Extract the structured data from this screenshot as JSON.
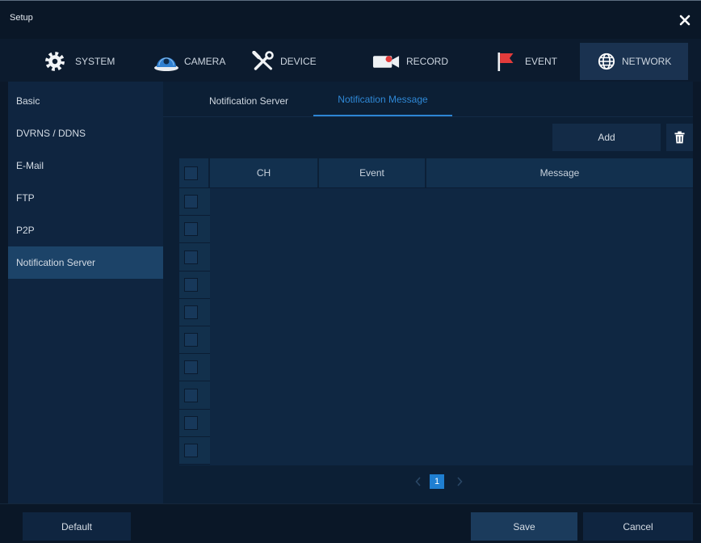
{
  "window": {
    "title": "Setup",
    "close_icon": "close-icon"
  },
  "tabs": [
    {
      "label": "SYSTEM",
      "icon": "gear-icon",
      "active": false
    },
    {
      "label": "CAMERA",
      "icon": "camera-icon",
      "active": false
    },
    {
      "label": "DEVICE",
      "icon": "tools-icon",
      "active": false
    },
    {
      "label": "RECORD",
      "icon": "record-icon",
      "active": false
    },
    {
      "label": "EVENT",
      "icon": "flag-icon",
      "active": false
    },
    {
      "label": "NETWORK",
      "icon": "globe-icon",
      "active": true
    }
  ],
  "sidebar": {
    "items": [
      {
        "label": "Basic",
        "active": false
      },
      {
        "label": "DVRNS / DDNS",
        "active": false
      },
      {
        "label": "E-Mail",
        "active": false
      },
      {
        "label": "FTP",
        "active": false
      },
      {
        "label": "P2P",
        "active": false
      },
      {
        "label": "Notification Server",
        "active": true
      }
    ]
  },
  "subtabs": [
    {
      "label": "Notification Server",
      "active": false
    },
    {
      "label": "Notification Message",
      "active": true
    }
  ],
  "toolbar": {
    "add_label": "Add",
    "delete_icon": "trash-icon"
  },
  "table": {
    "select_all_checked": false,
    "columns": [
      "CH",
      "Event",
      "Message"
    ],
    "rows": [
      {
        "checked": false,
        "ch": "",
        "event": "",
        "message": ""
      },
      {
        "checked": false,
        "ch": "",
        "event": "",
        "message": ""
      },
      {
        "checked": false,
        "ch": "",
        "event": "",
        "message": ""
      },
      {
        "checked": false,
        "ch": "",
        "event": "",
        "message": ""
      },
      {
        "checked": false,
        "ch": "",
        "event": "",
        "message": ""
      },
      {
        "checked": false,
        "ch": "",
        "event": "",
        "message": ""
      },
      {
        "checked": false,
        "ch": "",
        "event": "",
        "message": ""
      },
      {
        "checked": false,
        "ch": "",
        "event": "",
        "message": ""
      },
      {
        "checked": false,
        "ch": "",
        "event": "",
        "message": ""
      },
      {
        "checked": false,
        "ch": "",
        "event": "",
        "message": ""
      }
    ]
  },
  "pagination": {
    "prev_icon": "chevron-left-icon",
    "pages": [
      {
        "label": "1",
        "current": true
      }
    ],
    "next_icon": "chevron-right-icon"
  },
  "footer": {
    "default_label": "Default",
    "save_label": "Save",
    "cancel_label": "Cancel"
  },
  "colors": {
    "window_bg": "#0b1829",
    "sidebar_bg": "#0f2540",
    "active_tab_bg": "#1a3250",
    "active_sidebar_bg": "#1c4368",
    "accent": "#2f88d6",
    "current_page_bg": "#1f7fd1",
    "flag_red": "#e33b3b"
  }
}
